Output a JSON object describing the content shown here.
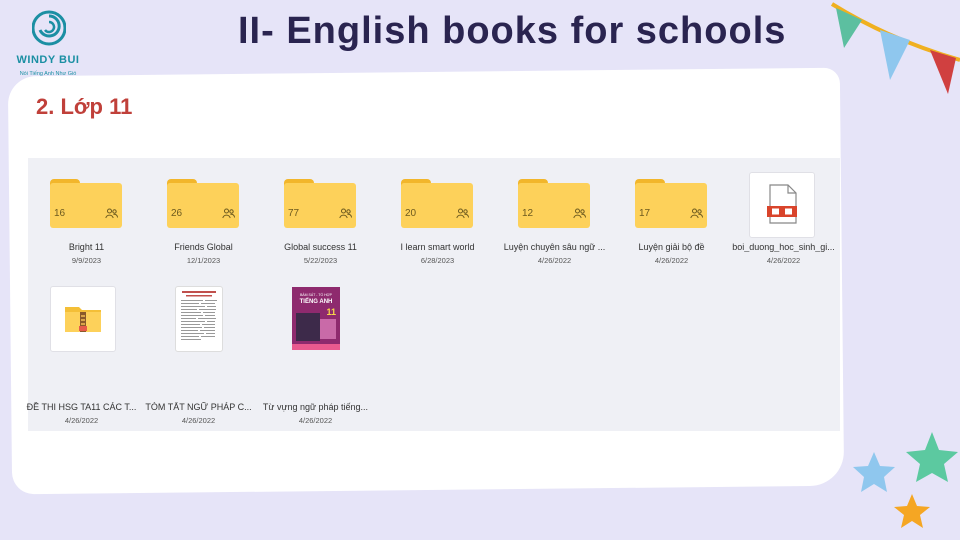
{
  "logo": {
    "name": "WINDY BUI",
    "slogan": "Nói Tiếng Anh Như Gió"
  },
  "header": {
    "title": "II- English books for schools",
    "subtitle": "2. Lớp 11"
  },
  "items": [
    {
      "type": "folder",
      "name": "Bright 11",
      "date": "9/9/2023",
      "count": "16"
    },
    {
      "type": "folder",
      "name": "Friends Global",
      "date": "12/1/2023",
      "count": "26"
    },
    {
      "type": "folder",
      "name": "Global success 11",
      "date": "5/22/2023",
      "count": "77"
    },
    {
      "type": "folder",
      "name": "I learn smart world",
      "date": "6/28/2023",
      "count": "20"
    },
    {
      "type": "folder",
      "name": "Luyện chuyên sâu ngữ ...",
      "date": "4/26/2022",
      "count": "12"
    },
    {
      "type": "folder",
      "name": "Luyện giải bộ đề",
      "date": "4/26/2022",
      "count": "17"
    },
    {
      "type": "file",
      "name": "boi_duong_hoc_sinh_gi...",
      "date": "4/26/2022"
    },
    {
      "type": "zip",
      "name": "ĐỀ THI HSG TA11 CÁC T...",
      "date": "4/26/2022"
    },
    {
      "type": "doc",
      "name": "TÓM TẮT NGỮ PHÁP C...",
      "date": "4/26/2022"
    },
    {
      "type": "book",
      "name": "Từ vựng ngữ pháp tiếng...",
      "date": "4/26/2022"
    }
  ],
  "book_cover": {
    "top_text": "BÁM SÁT - TỔ HỢP",
    "title": "TIẾNG ANH",
    "grade": "11"
  },
  "colors": {
    "background": "#e6e4f8",
    "title": "#2a2450",
    "subtitle": "#c0403a",
    "folder": "#fdd15a",
    "folder_tab": "#f2b62b",
    "logo": "#1b8fa3"
  },
  "icons": [
    "shared-people-icon",
    "pdf-file-icon",
    "zip-archive-icon",
    "star-icon",
    "bunting-flag-icon"
  ]
}
